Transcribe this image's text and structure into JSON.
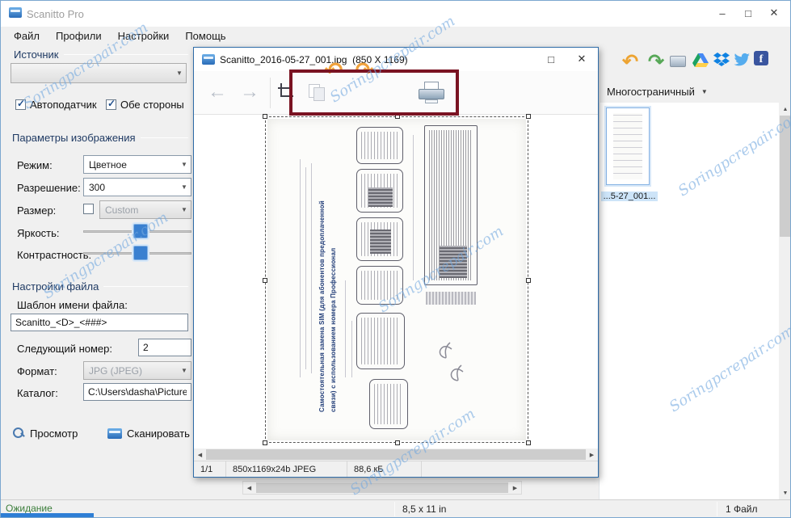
{
  "window": {
    "title": "Scanitto Pro",
    "menu": [
      {
        "label": "Файл"
      },
      {
        "label": "Профили"
      },
      {
        "label": "Настройки"
      },
      {
        "label": "Помощь"
      }
    ]
  },
  "source": {
    "title": "Источник",
    "autofeed": "Автоподатчик",
    "both_sides": "Обе стороны"
  },
  "image_params": {
    "title": "Параметры изображения",
    "mode_label": "Режим:",
    "mode_value": "Цветное",
    "resolution_label": "Разрешение:",
    "resolution_value": "300",
    "size_label": "Размер:",
    "size_value": "Custom",
    "brightness_label": "Яркость:",
    "contrast_label": "Контрастность:"
  },
  "file_settings": {
    "title": "Настройки файла",
    "template_label": "Шаблон имени файла:",
    "template_value": "Scanitto_<D>_<###>",
    "next_label": "Следующий номер:",
    "next_value": "2",
    "format_label": "Формат:",
    "format_value": "JPG (JPEG)",
    "folder_label": "Каталог:",
    "folder_value": "C:\\Users\\dasha\\Pictures"
  },
  "actions": {
    "preview": "Просмотр",
    "scan": "Сканировать"
  },
  "right_panel": {
    "multipage": "Многостраничный",
    "thumb_label": "...5-27_001..."
  },
  "status_bar": {
    "state": "Ожидание",
    "page_size": "8,5 x 11 in",
    "file_count": "1 Файл"
  },
  "viewer": {
    "title": "Scanitto_2016-05-27_001.jpg  (850 X 1169)",
    "page": "1/1",
    "image_info": "850x1169x24b JPEG",
    "file_size": "88,6 кБ"
  },
  "document": {
    "heading_line1": "Самостоятельная замена SIM (для абонентов предоплаченной",
    "heading_line2": "связи) с использованием номера Профессионал"
  },
  "watermark": {
    "text": "Soringpcrepair.com"
  },
  "icons": {
    "minimize_glyph": "–",
    "maximize_glyph": "□",
    "close_glyph": "✕",
    "back_glyph": "←",
    "forward_glyph": "→",
    "undo_glyph": "↶",
    "redo_glyph": "↷",
    "rotate_left_glyph": "↶",
    "rotate_right_glyph": "↷",
    "dropdown_glyph": "▼",
    "check_glyph": "✓",
    "left_arrow_glyph": "◀",
    "right_arrow_glyph": "▶",
    "up_arrow_glyph": "▲",
    "down_arrow_glyph": "▼",
    "facebook_glyph": "f"
  },
  "colors": {
    "accent": "#2f7cd6",
    "highlight_box": "#7a1322",
    "rotate_arrow": "#f0a23c"
  }
}
